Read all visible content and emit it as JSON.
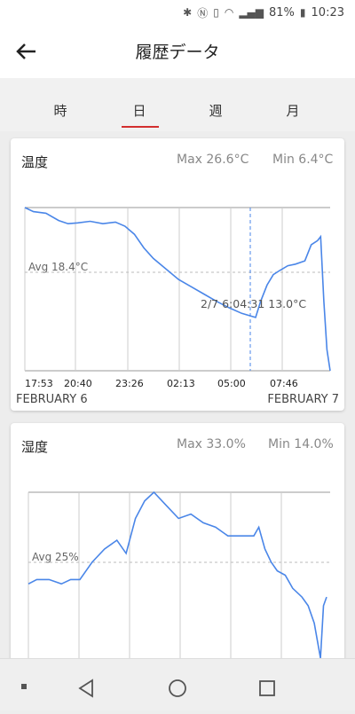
{
  "status_bar": {
    "battery": "81%",
    "time": "10:23"
  },
  "header": {
    "title": "履歴データ"
  },
  "tabs": [
    {
      "label": "時"
    },
    {
      "label": "日"
    },
    {
      "label": "週"
    },
    {
      "label": "月"
    }
  ],
  "selected_tab": "日",
  "accent_color": "#d32f2f",
  "line_color": "#4a86e8",
  "temperature_card": {
    "title": "温度",
    "max_label": "Max 26.6°C",
    "min_label": "Min 6.4°C",
    "avg_label": "Avg 18.4°C",
    "tooltip": "2/7 6:04:31 13.0°C",
    "start_date": "FEBRUARY 6",
    "end_date": "FEBRUARY 7",
    "x_ticks": [
      "17:53",
      "20:40",
      "23:26",
      "02:13",
      "05:00",
      "07:46"
    ]
  },
  "humidity_card": {
    "title": "湿度",
    "max_label": "Max 33.0%",
    "min_label": "Min 14.0%",
    "avg_label": "Avg 25%"
  },
  "chart_data": [
    {
      "type": "line",
      "title": "温度",
      "unit": "°C",
      "ylim": [
        6.4,
        26.6
      ],
      "avg": 18.4,
      "x_ticks": [
        "17:53",
        "20:40",
        "23:26",
        "02:13",
        "05:00",
        "07:46"
      ],
      "x_range": [
        "2/6 17:53",
        "2/7 10:00"
      ],
      "highlight": {
        "time": "2/7 6:04:31",
        "value": 13.0
      },
      "series": [
        {
          "x": [
            "17:53",
            "18:20",
            "19:00",
            "19:40",
            "20:10",
            "20:40",
            "21:20",
            "22:00",
            "22:40",
            "23:10",
            "23:40",
            "00:10",
            "00:40",
            "01:20",
            "02:00",
            "02:40",
            "03:20",
            "04:00",
            "04:40",
            "05:20",
            "06:04",
            "06:20",
            "06:40",
            "07:00",
            "07:20",
            "07:46",
            "08:10",
            "08:40",
            "09:00",
            "09:20",
            "09:30",
            "09:40",
            "09:50",
            "10:00"
          ],
          "values": [
            26.6,
            26.1,
            25.9,
            25.0,
            24.6,
            24.7,
            24.9,
            24.6,
            24.8,
            24.3,
            23.3,
            21.6,
            20.3,
            19.0,
            17.7,
            16.8,
            15.9,
            15.0,
            14.2,
            13.5,
            13.0,
            15.0,
            17.0,
            18.3,
            18.8,
            19.4,
            19.6,
            20.0,
            22.0,
            22.5,
            23.0,
            15.0,
            9.0,
            6.4
          ]
        }
      ]
    },
    {
      "type": "line",
      "title": "湿度",
      "unit": "%",
      "ylim": [
        14.0,
        33.0
      ],
      "avg": 25,
      "series": [
        {
          "x": [
            "17:53",
            "18:20",
            "19:00",
            "19:40",
            "20:10",
            "20:40",
            "21:20",
            "22:00",
            "22:40",
            "23:10",
            "23:40",
            "00:10",
            "00:40",
            "01:20",
            "02:00",
            "02:40",
            "03:20",
            "04:00",
            "04:40",
            "05:20",
            "06:04",
            "06:20",
            "06:40",
            "07:00",
            "07:20",
            "07:46",
            "08:10",
            "08:40",
            "09:00",
            "09:20",
            "09:30",
            "09:40",
            "09:50",
            "10:00"
          ],
          "values": [
            22.5,
            23.0,
            23.0,
            22.5,
            23.0,
            23.0,
            25.0,
            26.5,
            27.5,
            26.0,
            30.0,
            32.0,
            33.0,
            31.5,
            30.0,
            30.5,
            29.5,
            29.0,
            28.0,
            28.0,
            28.0,
            29.0,
            26.5,
            25.0,
            24.0,
            23.5,
            22.0,
            21.0,
            20.0,
            18.0,
            16.0,
            14.0,
            20.0,
            21.0
          ]
        }
      ]
    }
  ]
}
